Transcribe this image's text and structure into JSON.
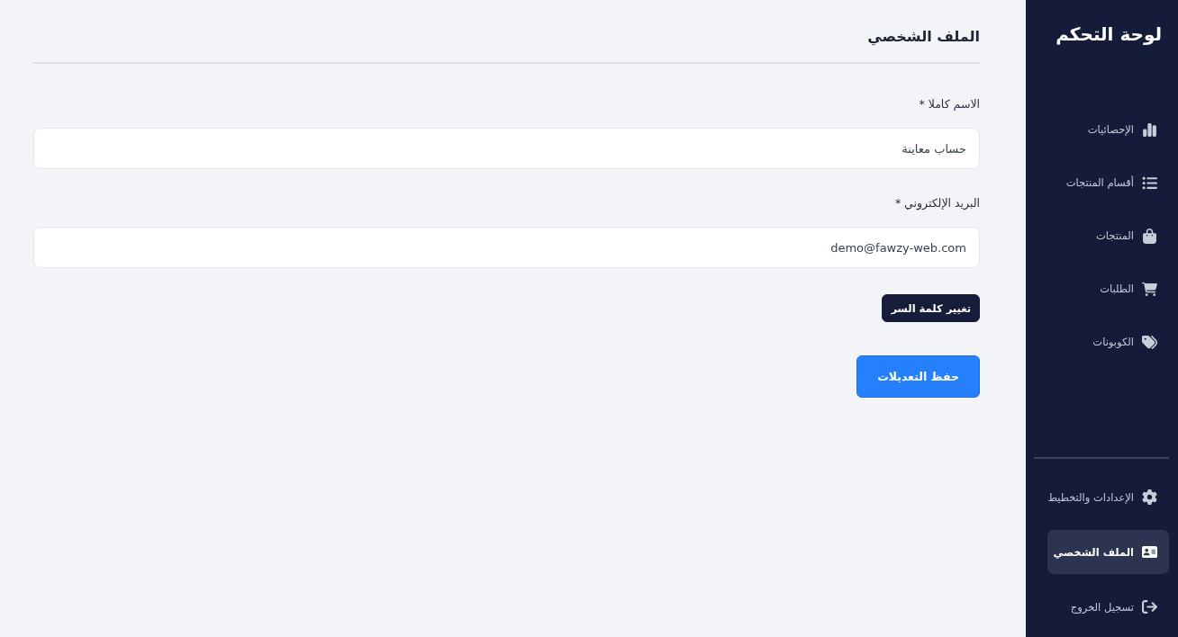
{
  "sidebar": {
    "title": "لوحة التحكم",
    "items": [
      {
        "label": "الإحصائيات",
        "selected": false
      },
      {
        "label": "أقسام المنتجات",
        "selected": false
      },
      {
        "label": "المنتجات",
        "selected": false
      },
      {
        "label": "الطلبات",
        "selected": false
      },
      {
        "label": "الكوبونات",
        "selected": false
      }
    ],
    "footer_items": [
      {
        "label": "الإعدادات والتخطيط",
        "selected": false
      },
      {
        "label": "الملف الشخصي",
        "selected": true
      },
      {
        "label": "تسجيل الخروج",
        "selected": false
      }
    ]
  },
  "page": {
    "title": "الملف الشخصي"
  },
  "form": {
    "fields": [
      {
        "label": "الاسم كاملا *",
        "value": "حساب معاينة"
      },
      {
        "label": "البريد الإلكتروني *",
        "value": "demo@fawzy-web.com"
      }
    ],
    "buttons": [
      {
        "kind": "secondary",
        "label": "تغيير كلمة السر"
      },
      {
        "kind": "primary",
        "label": "حفظ التعديلات"
      }
    ]
  }
}
